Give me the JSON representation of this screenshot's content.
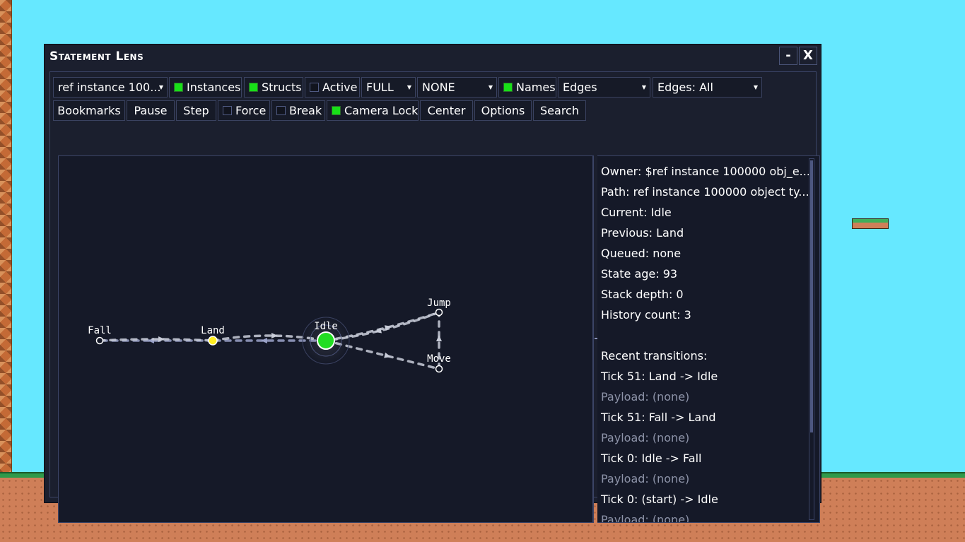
{
  "window": {
    "title": "Statement Lens",
    "minimize_label": "-",
    "close_label": "X"
  },
  "toolbar": {
    "row1": {
      "target_dropdown": "ref instance 100...",
      "instances": {
        "label": "Instances",
        "checked": true
      },
      "structs": {
        "label": "Structs",
        "checked": true
      },
      "active": {
        "label": "Active",
        "checked": false
      },
      "detail_dropdown": "FULL",
      "filter_dropdown": "NONE",
      "names": {
        "label": "Names",
        "checked": true
      },
      "edges_dropdown": "Edges",
      "edges_filter_dropdown": "Edges: All"
    },
    "row2": {
      "bookmarks": "Bookmarks",
      "pause": "Pause",
      "step": "Step",
      "force": {
        "label": "Force",
        "checked": false
      },
      "break": {
        "label": "Break",
        "checked": false
      },
      "camera_lock": {
        "label": "Camera Lock",
        "checked": true
      },
      "center": "Center",
      "options": "Options",
      "search": "Search"
    }
  },
  "graph": {
    "nodes": [
      {
        "name": "Fall",
        "state": "normal"
      },
      {
        "name": "Land",
        "state": "previous"
      },
      {
        "name": "Idle",
        "state": "current"
      },
      {
        "name": "Jump",
        "state": "normal"
      },
      {
        "name": "Move",
        "state": "normal"
      }
    ],
    "colors": {
      "current": "#22dd22",
      "previous": "#ffee22",
      "normal": "#ffffff",
      "edge": "#c8ccd8"
    }
  },
  "info": {
    "owner": "Owner: $ref instance 100000 obj_e...",
    "path": "Path: ref instance 100000 object ty...",
    "current": "Current: Idle",
    "previous": "Previous: Land",
    "queued": "Queued: none",
    "state_age": "State age: 93",
    "stack_depth": "Stack depth: 0",
    "history_count": "History count: 3",
    "recent_header": "Recent transitions:",
    "transitions": [
      {
        "text": "Tick 51: Land -> Idle",
        "payload": "Payload: (none)"
      },
      {
        "text": "Tick 51: Fall -> Land",
        "payload": "Payload: (none)"
      },
      {
        "text": "Tick 0: Idle -> Fall",
        "payload": "Payload: (none)"
      },
      {
        "text": "Tick 0: (start) -> Idle",
        "payload": "Payload: (none)"
      }
    ]
  }
}
